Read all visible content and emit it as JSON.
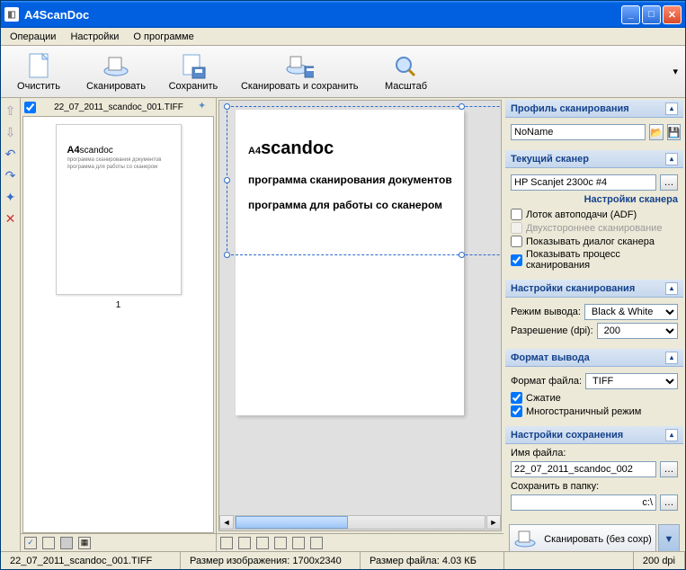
{
  "window": {
    "title": "A4ScanDoc"
  },
  "menu": {
    "operations": "Операции",
    "settings": "Настройки",
    "about": "О программе"
  },
  "toolbar": {
    "clear": "Очистить",
    "scan": "Сканировать",
    "save": "Сохранить",
    "scan_save": "Сканировать и сохранить",
    "zoom": "Масштаб"
  },
  "thumb": {
    "filename": "22_07_2011_scandoc_001.TIFF",
    "page_num": "1"
  },
  "preview": {
    "logo_big": "A4",
    "logo_small": "scandoc",
    "line1": "программа сканирования  документов",
    "line2": "программа для работы со сканером",
    "thumb_line1": "программа сканирования  документов",
    "thumb_line2": "программа для работы со сканером"
  },
  "sections": {
    "profile": {
      "title": "Профиль сканирования",
      "value": "NoName"
    },
    "scanner": {
      "title": "Текущий сканер",
      "value": "HP Scanjet 2300c #4",
      "settings_title": "Настройки сканера",
      "adf": "Лоток автоподачи (ADF)",
      "duplex": "Двухстороннее сканирование",
      "show_dialog": "Показывать диалог сканера",
      "show_process": "Показывать процесс сканирования"
    },
    "scan_settings": {
      "title": "Настройки сканирования",
      "output_mode": "Режим вывода:",
      "output_mode_val": "Black & White",
      "resolution": "Разрешение (dpi):",
      "resolution_val": "200"
    },
    "format": {
      "title": "Формат вывода",
      "file_format": "Формат файла:",
      "file_format_val": "TIFF",
      "compress": "Сжатие",
      "multipage": "Многостраничный режим"
    },
    "save": {
      "title": "Настройки сохранения",
      "filename_lbl": "Имя файла:",
      "filename_val": "22_07_2011_scandoc_002",
      "folder_lbl": "Сохранить в папку:",
      "folder_val": "c:\\"
    }
  },
  "scan_btn": "Сканировать (без сохр)",
  "status": {
    "file": "22_07_2011_scandoc_001.TIFF",
    "dims": "Размер изображения: 1700x2340",
    "size": "Размер файла: 4.03 КБ",
    "dpi": "200 dpi"
  }
}
